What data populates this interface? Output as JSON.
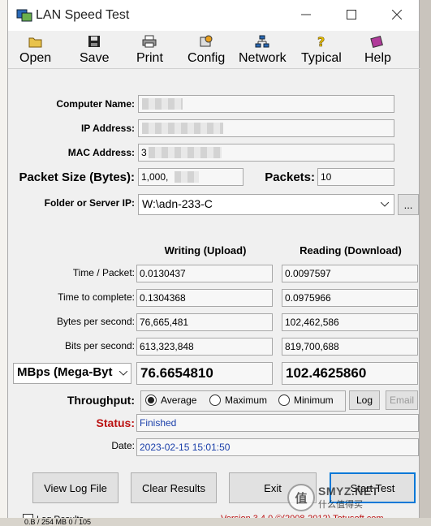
{
  "window": {
    "title": "LAN Speed Test"
  },
  "toolbar": {
    "open": "Open",
    "save": "Save",
    "print": "Print",
    "config": "Config",
    "network": "Network",
    "typical": "Typical",
    "help": "Help"
  },
  "form": {
    "computer_name_label": "Computer Name:",
    "ip_label": "IP Address:",
    "mac_label": "MAC Address:",
    "mac_value_prefix": "3",
    "packet_size_label": "Packet Size (Bytes):",
    "packet_size_value": "1,000,",
    "packets_label": "Packets:",
    "packets_value": "10",
    "folder_label": "Folder or Server IP:",
    "folder_value": "W:\\adn-233-C",
    "browse_label": "..."
  },
  "results": {
    "writing_header": "Writing (Upload)",
    "reading_header": "Reading (Download)",
    "rows": [
      {
        "label": "Time / Packet:",
        "write": "0.0130437",
        "read": "0.0097597"
      },
      {
        "label": "Time to complete:",
        "write": "0.1304368",
        "read": "0.0975966"
      },
      {
        "label": "Bytes per second:",
        "write": "76,665,481",
        "read": "102,462,586"
      },
      {
        "label": "Bits per second:",
        "write": "613,323,848",
        "read": "819,700,688"
      }
    ],
    "unit_select": "MBps (Mega-Byt",
    "write_big": "76.6654810",
    "read_big": "102.4625860"
  },
  "throughput": {
    "label": "Throughput:",
    "options": [
      "Average",
      "Maximum",
      "Minimum"
    ],
    "selected": "Average",
    "log_button": "Log",
    "email_button": "Email"
  },
  "status": {
    "label": "Status:",
    "value": "Finished",
    "date_label": "Date:",
    "date_value": "2023-02-15 15:01:50"
  },
  "buttons": {
    "view_log": "View Log File",
    "clear": "Clear Results",
    "exit": "Exit",
    "start": "Start Test"
  },
  "footer": {
    "log_results": "Log Results",
    "version": "Version 3.4.0  ©(2008-2012)  Totusoft.com",
    "bottom_left": "0.B / 254 MB  0 / 105"
  },
  "colors": {
    "status_label": "#b11111",
    "status_value": "#1a3faa",
    "accent": "#0078d7"
  },
  "watermark": {
    "text": "SMYZ.NET",
    "top": "值",
    "bottom": "什么值得买"
  }
}
